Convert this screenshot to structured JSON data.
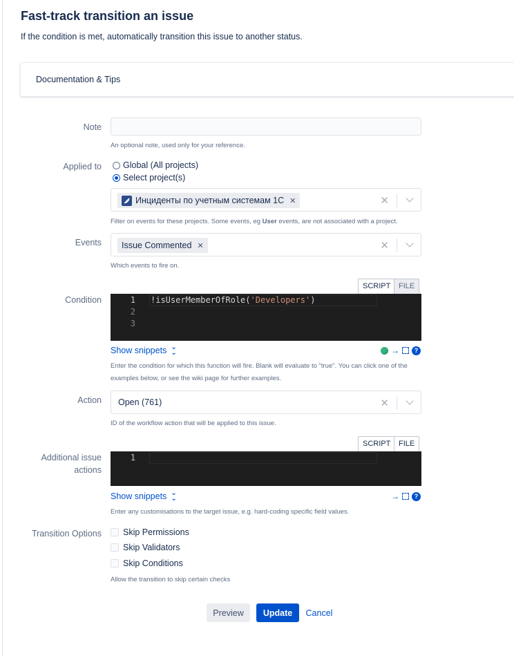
{
  "page": {
    "title": "Fast-track transition an issue",
    "subtitle": "If the condition is met, automatically transition this issue to another status."
  },
  "docs": {
    "label": "Documentation & Tips"
  },
  "note": {
    "label": "Note",
    "value": "",
    "help": "An optional note, used only for your reference."
  },
  "applied_to": {
    "label": "Applied to",
    "options": [
      {
        "label": "Global (All projects)",
        "checked": false
      },
      {
        "label": "Select project(s)",
        "checked": true
      }
    ],
    "selected_project": "Инциденты по учетным системам 1С",
    "help_pre": "Filter on events for these projects. Some events, eg ",
    "help_bold": "User",
    "help_post": " events, are not associated with a project."
  },
  "events": {
    "label": "Events",
    "selected": "Issue Commented",
    "help": "Which events to fire on."
  },
  "condition": {
    "label": "Condition",
    "tabs": [
      "SCRIPT",
      "FILE"
    ],
    "active_tab": "SCRIPT",
    "lines": [
      "1",
      "2",
      "3"
    ],
    "code_prefix": "!isUserMemberOfRole(",
    "code_string": "'Developers'",
    "code_suffix": ")",
    "snippets_label": "Show snippets",
    "status_color": "#36b37e",
    "help_line1": "Enter the condition for which this function will fire. Blank will evaluate to \"true\". You can click one of the",
    "help_line2": "examples below, or see the wiki page for further examples."
  },
  "action": {
    "label": "Action",
    "value": "Open (761)",
    "help": "ID of the workflow action that will be applied to this issue."
  },
  "additional": {
    "label_line1": "Additional issue",
    "label_line2": "actions",
    "tabs": [
      "SCRIPT",
      "FILE"
    ],
    "active_tab": "FILE",
    "lines": [
      "1"
    ],
    "snippets_label": "Show snippets",
    "help": "Enter any customisations to the target issue, e.g. hard-coding specific field values."
  },
  "transition_options": {
    "label": "Transition Options",
    "options": [
      {
        "label": "Skip Permissions",
        "checked": false
      },
      {
        "label": "Skip Validators",
        "checked": false
      },
      {
        "label": "Skip Conditions",
        "checked": false
      }
    ],
    "help": "Allow the transition to skip certain checks"
  },
  "buttons": {
    "preview": "Preview",
    "update": "Update",
    "cancel": "Cancel"
  },
  "icons": {
    "remove_tag": "close-icon",
    "clear": "clear-icon",
    "dropdown": "chevron-down-icon",
    "snippets": "double-chevron-down-icon",
    "run": "arrow-right-icon",
    "expand": "expand-icon",
    "help": "help-icon",
    "project": "rocket-icon"
  },
  "colors": {
    "primary": "#0052cc",
    "editor_bg": "#1e1e1e",
    "string": "#ce9178"
  }
}
